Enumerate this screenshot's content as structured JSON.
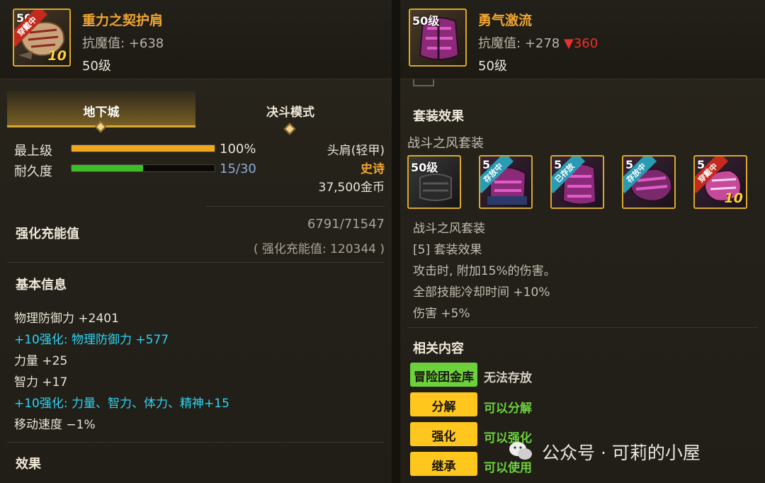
{
  "left_item": {
    "name": "重力之契护肩",
    "resist_label": "抗魔值:",
    "resist_value": "+638",
    "level_text": "50级",
    "icon": {
      "level_badge": "50",
      "ribbon": "穿戴中",
      "enhance": "10",
      "name": "shoulder-armor-icon"
    }
  },
  "tabs": [
    {
      "label": "地下城",
      "active": true
    },
    {
      "label": "决斗模式",
      "active": false
    }
  ],
  "bars": [
    {
      "label": "最上级",
      "value_text": "100%",
      "fraction": 1.0,
      "color": "#f0a720"
    },
    {
      "label": "耐久度",
      "value_text": "15/30",
      "fraction": 0.5,
      "color": "#3dbd2a"
    }
  ],
  "item_info": {
    "slot": "头肩(轻甲)",
    "rarity": "史诗",
    "rarity_color": "#f0a531",
    "price": "37,500金币"
  },
  "charge": {
    "title": "强化充能值",
    "value": "6791/71547",
    "sub": "( 强化充能值: 120344 )"
  },
  "basic_info": {
    "title": "基本信息",
    "stats": [
      {
        "text": "物理防御力 +2401",
        "style": "normal"
      },
      {
        "text": "+10强化: 物理防御力 +577",
        "style": "cyan"
      },
      {
        "text": "力量 +25",
        "style": "normal"
      },
      {
        "text": "智力 +17",
        "style": "normal"
      },
      {
        "text": "+10强化: 力量、智力、体力、精神+15",
        "style": "cyan"
      },
      {
        "text": "移动速度 −1%",
        "style": "normal"
      }
    ]
  },
  "effect_title": "效果",
  "right_item": {
    "name": "勇气激流",
    "resist_label": "抗魔值:",
    "resist_value": "+278",
    "resist_down": "▼360",
    "level_text": "50级",
    "icon": {
      "level_badge": "50级",
      "name": "chest-armor-icon"
    }
  },
  "set_effect": {
    "title": "套装效果",
    "set_name": "战斗之风套装",
    "pieces": [
      {
        "badge": "50级",
        "ribbon": "",
        "enhance": ""
      },
      {
        "badge": "5",
        "ribbon": "存放中",
        "enhance": ""
      },
      {
        "badge": "5",
        "ribbon": "已存放",
        "enhance": ""
      },
      {
        "badge": "5",
        "ribbon": "存放中",
        "enhance": ""
      },
      {
        "badge": "5",
        "ribbon": "穿戴中",
        "enhance": "10"
      }
    ],
    "desc_name": "战斗之风套装",
    "desc_lines": [
      "[5] 套装效果",
      "攻击时, 附加15%的伤害。",
      "全部技能冷却时间 +10%",
      "伤害 +5%"
    ]
  },
  "related": {
    "title": "相关内容",
    "rows": [
      {
        "tag": "冒险团金库",
        "tag_color": "green",
        "status": "无法存放",
        "status_color": "#d6d0c4"
      },
      {
        "tag": "分解",
        "tag_color": "yellow",
        "status": "可以分解",
        "status_color": "#6dd13c"
      },
      {
        "tag": "强化",
        "tag_color": "yellow",
        "status": "可以强化",
        "status_color": "#6dd13c"
      },
      {
        "tag": "继承",
        "tag_color": "yellow",
        "status": "可以使用",
        "status_color": "#6dd13c"
      }
    ]
  },
  "watermark": "公众号 · 可莉的小屋"
}
